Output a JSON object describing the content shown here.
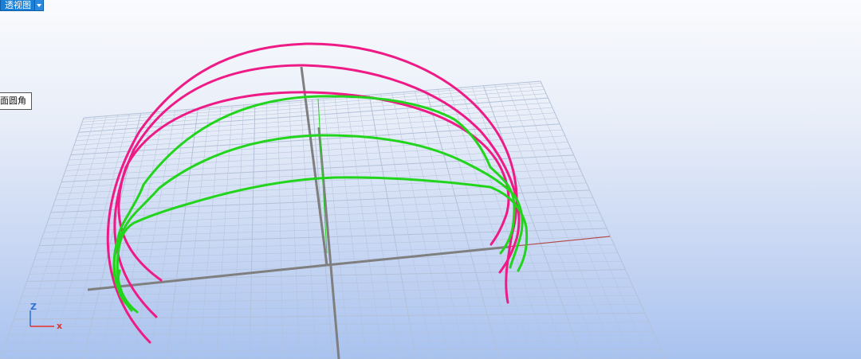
{
  "viewport": {
    "view_name": "透视图",
    "dropdown_icon": "chevron-down-icon"
  },
  "tooltip": {
    "text": "面圆角"
  },
  "axes_widget": {
    "z_label": "Z",
    "x_label": "x",
    "z_color": "#2f6fd6",
    "x_color": "#e8302a"
  },
  "colors": {
    "curve_magenta": "#ee1a86",
    "curve_green": "#22d41c",
    "grid_line": "#b3c1d8",
    "axis_gray": "#7f7f7f",
    "axis_x_red": "#b04545"
  }
}
